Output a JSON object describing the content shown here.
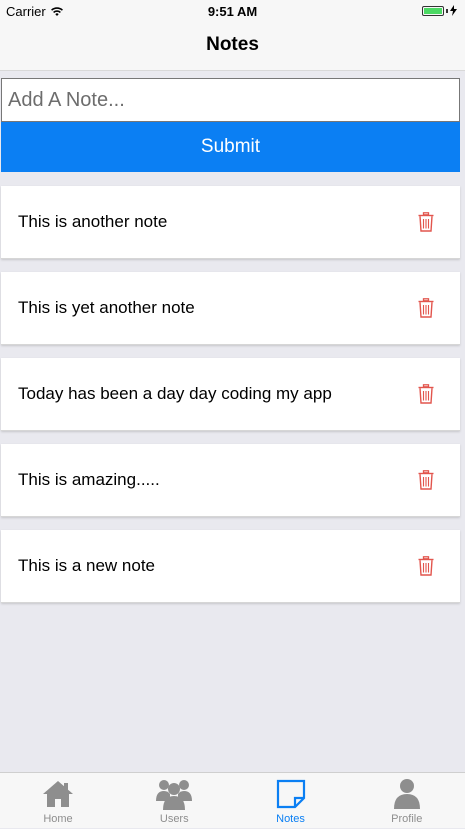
{
  "status_bar": {
    "carrier": "Carrier",
    "time": "9:51 AM"
  },
  "nav": {
    "title": "Notes"
  },
  "note_form": {
    "placeholder": "Add A Note...",
    "value": "",
    "submit_label": "Submit"
  },
  "notes": [
    {
      "text": "This is another note"
    },
    {
      "text": "This is yet another note"
    },
    {
      "text": "Today has been a day day coding my app"
    },
    {
      "text": "This is amazing....."
    },
    {
      "text": "This is a new note"
    }
  ],
  "tabs": [
    {
      "label": "Home",
      "icon": "home-icon"
    },
    {
      "label": "Users",
      "icon": "users-icon"
    },
    {
      "label": "Notes",
      "icon": "note-icon",
      "active": true
    },
    {
      "label": "Profile",
      "icon": "profile-icon"
    }
  ],
  "colors": {
    "accent": "#0b7ff3",
    "trash": "#e2554d",
    "inactive_tab": "#8e8e8e"
  }
}
